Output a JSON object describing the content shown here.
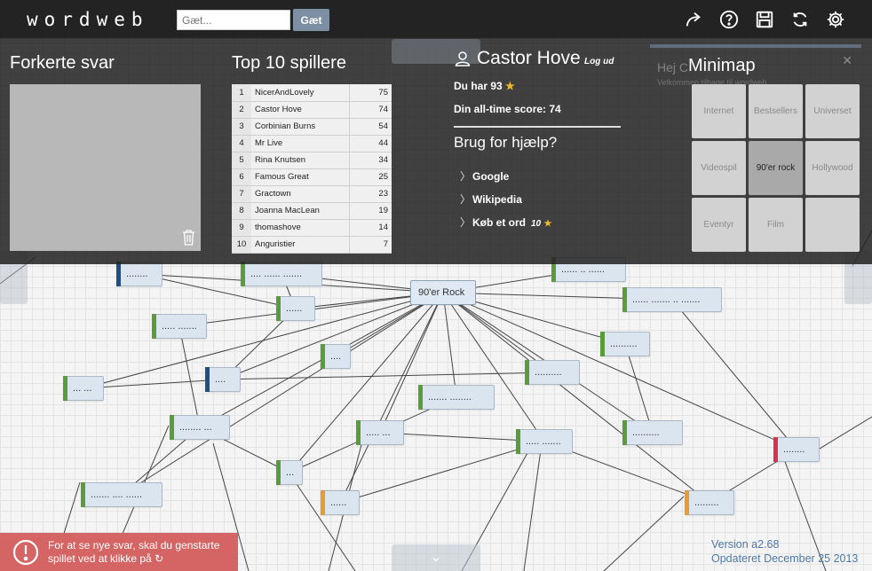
{
  "app": {
    "logo": "wordweb"
  },
  "search": {
    "placeholder": "Gæt...",
    "value": "",
    "button_label": "Gæt"
  },
  "toolbar": {
    "icons": [
      "share-icon",
      "help-icon",
      "save-icon",
      "refresh-icon",
      "settings-icon"
    ]
  },
  "wrong_answers": {
    "title": "Forkerte svar"
  },
  "top10": {
    "title": "Top 10 spillere",
    "rows": [
      {
        "rank": "1",
        "name": "NicerAndLovely",
        "score": "75"
      },
      {
        "rank": "2",
        "name": "Castor Hove",
        "score": "74"
      },
      {
        "rank": "3",
        "name": "Corbinian Burns",
        "score": "54"
      },
      {
        "rank": "4",
        "name": "Mr Live",
        "score": "44"
      },
      {
        "rank": "5",
        "name": "Rina Knutsen",
        "score": "34"
      },
      {
        "rank": "6",
        "name": "Famous Great",
        "score": "25"
      },
      {
        "rank": "7",
        "name": "Gractown",
        "score": "23"
      },
      {
        "rank": "8",
        "name": "Joanna MacLean",
        "score": "19"
      },
      {
        "rank": "9",
        "name": "thomashove",
        "score": "14"
      },
      {
        "rank": "10",
        "name": "Anguristier",
        "score": "7"
      }
    ]
  },
  "user": {
    "name": "Castor Hove",
    "logout": "Log ud",
    "coins_text": "Du har 93",
    "alltime_text": "Din all-time score: 74"
  },
  "help": {
    "title": "Brug for hjælp?",
    "links": [
      {
        "label": "Google",
        "cost": ""
      },
      {
        "label": "Wikipedia",
        "cost": ""
      },
      {
        "label": "Køb et ord",
        "cost": "10"
      }
    ]
  },
  "minimap": {
    "title": "Minimap",
    "cells": [
      "Internet",
      "Bestsellers",
      "Universet",
      "Videospil",
      "90'er rock",
      "Hollywood",
      "Eventyr",
      "Film",
      ""
    ],
    "active_index": 4
  },
  "background_hint": {
    "text1": "Hej C",
    "text2": "Velkommen tilbage til wordweb"
  },
  "graph": {
    "root_label": "90'er Rock",
    "nodes": [
      {
        "label": "........",
        "color": "#1d4f86"
      },
      {
        "label": ".... ...... .......",
        "color": "#5b9c3a"
      },
      {
        "label": "...... .. ......",
        "color": "#5b9c3a"
      },
      {
        "label": "......",
        "color": "#5b9c3a"
      },
      {
        "label": "..... .......",
        "color": "#5b9c3a"
      },
      {
        "label": "...... ....... .. .......",
        "color": "#5b9c3a"
      },
      {
        "label": "....",
        "color": "#5b9c3a"
      },
      {
        "label": "..........",
        "color": "#5b9c3a"
      },
      {
        "label": "....",
        "color": "#1d4f86"
      },
      {
        "label": "... ...",
        "color": "#5b9c3a"
      },
      {
        "label": "..........",
        "color": "#5b9c3a"
      },
      {
        "label": "....... ........",
        "color": "#5b9c3a"
      },
      {
        "label": "........ ...",
        "color": "#5b9c3a"
      },
      {
        "label": "..... ...",
        "color": "#5b9c3a"
      },
      {
        "label": "..... .......",
        "color": "#5b9c3a"
      },
      {
        "label": "..........",
        "color": "#5b9c3a"
      },
      {
        "label": "........",
        "color": "#d9324a"
      },
      {
        "label": "...",
        "color": "#5b9c3a"
      },
      {
        "label": "....... .... ......",
        "color": "#5b9c3a"
      },
      {
        "label": "......",
        "color": "#e79c33"
      },
      {
        "label": ".........",
        "color": "#e79c33"
      }
    ]
  },
  "notice": {
    "text": "For at se nye svar, skal du genstarte spillet ved at klikke på"
  },
  "version": {
    "line1": "Version a2.68",
    "line2": "Opdateret December 25 2013"
  }
}
